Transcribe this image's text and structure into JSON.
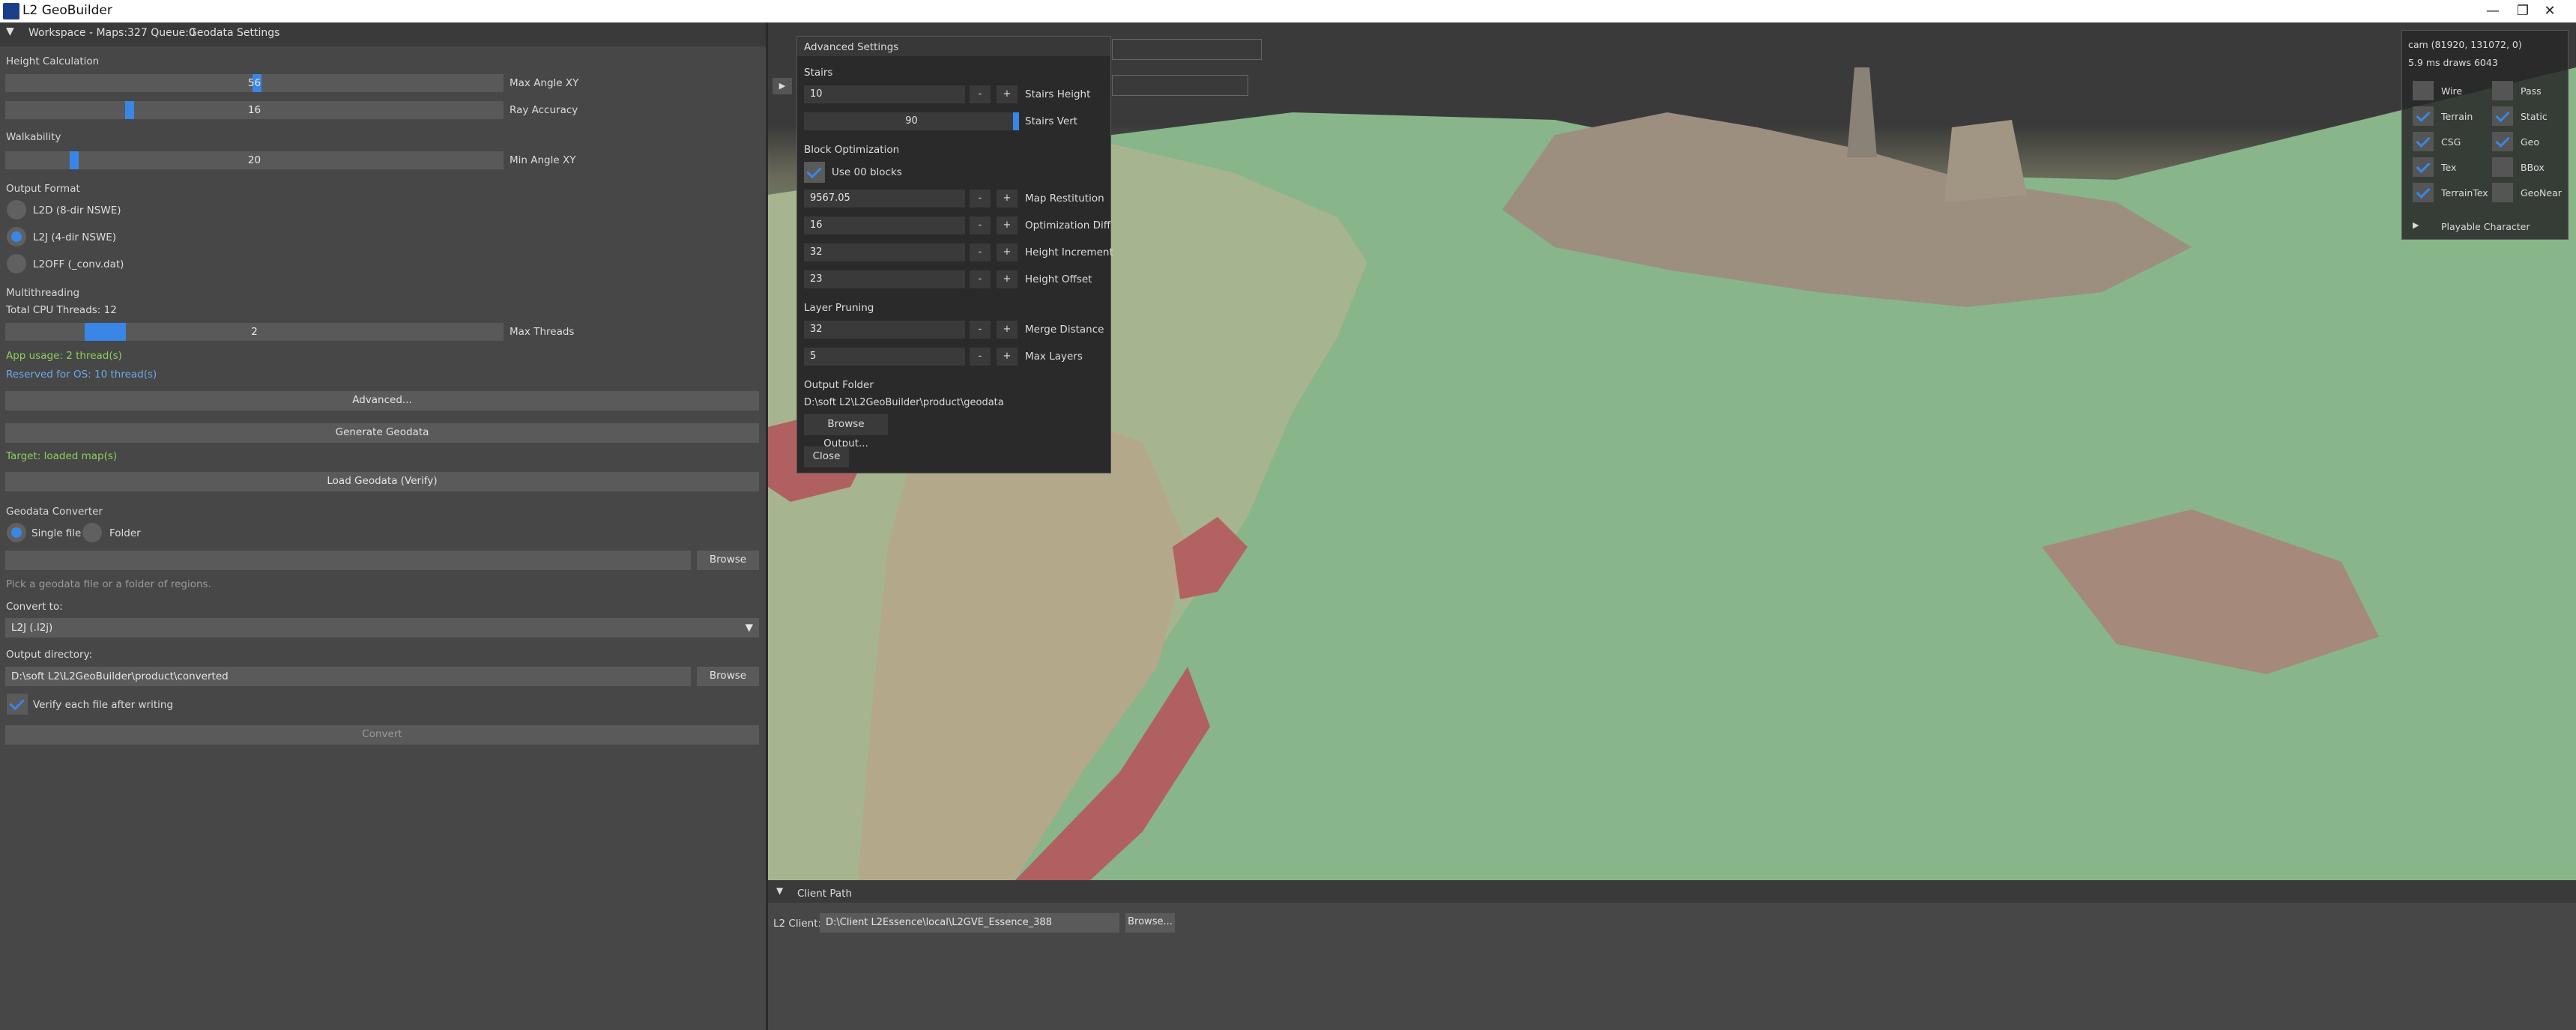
{
  "window": {
    "title": "L2 GeoBuilder",
    "minimize": "—",
    "restore": "❐",
    "close": "✕"
  },
  "menubar": {
    "workspace": "Workspace - Maps:327 Queue:0",
    "tab": "Geodata Settings"
  },
  "height_calc": {
    "title": "Height Calculation",
    "max_angle": {
      "value": "56",
      "label": "Max Angle XY",
      "level": 0.54
    },
    "ray_accuracy": {
      "value": "16",
      "label": "Ray Accuracy",
      "level": 0.24
    }
  },
  "walkability": {
    "title": "Walkability",
    "min_angle": {
      "value": "20",
      "label": "Min Angle XY",
      "level": 0.13
    }
  },
  "output_format": {
    "title": "Output Format",
    "options": [
      {
        "label": "L2D (8-dir NSWE)",
        "selected": false
      },
      {
        "label": "L2J (4-dir NSWE)",
        "selected": true
      },
      {
        "label": "L2OFF (_conv.dat)",
        "selected": false
      }
    ]
  },
  "multithreading": {
    "title": "Multithreading",
    "total": "Total CPU Threads: 12",
    "threads": {
      "value": "2",
      "label": "Max Threads",
      "level": 0.17
    },
    "app_usage": "App usage: 2 thread(s)",
    "reserved": "Reserved for OS: 10 thread(s)"
  },
  "actions": {
    "advanced": "Advanced...",
    "generate": "Generate Geodata",
    "target": "Target: loaded map(s)",
    "load": "Load Geodata (Verify)"
  },
  "converter": {
    "title": "Geodata Converter",
    "single_file": "Single file",
    "folder": "Folder",
    "file_value": "",
    "browse": "Browse",
    "hint": "Pick a geodata file or a folder of regions.",
    "convert_to_label": "Convert to:",
    "convert_to_value": "L2J  (.l2j)",
    "output_dir_label": "Output directory:",
    "output_dir_value": "D:\\soft L2\\L2GeoBuilder\\product\\converted",
    "browse2": "Browse",
    "verify": "Verify each file after writing",
    "convert": "Convert"
  },
  "dialog": {
    "title": "Advanced Settings",
    "stairs_title": "Stairs",
    "stairs_height": {
      "value": "10",
      "label": "Stairs Height"
    },
    "stairs_vert": {
      "value": "90",
      "label": "Stairs Vert",
      "level": 1.0
    },
    "block_title": "Block Optimization",
    "use00": "Use 00 blocks",
    "map_restitution": {
      "value": "9567.05",
      "label": "Map Restitution"
    },
    "opt_diff": {
      "value": "16",
      "label": "Optimization Diff"
    },
    "height_inc": {
      "value": "32",
      "label": "Height Increment"
    },
    "height_off": {
      "value": "23",
      "label": "Height Offset"
    },
    "pruning_title": "Layer Pruning",
    "merge_dist": {
      "value": "32",
      "label": "Merge Distance"
    },
    "max_layers": {
      "value": "5",
      "label": "Max Layers"
    },
    "output_title": "Output Folder",
    "output_path": "D:\\soft L2\\L2GeoBuilder\\product\\geodata",
    "browse_output": "Browse Output...",
    "close": "Close",
    "minus": "-",
    "plus": "+"
  },
  "overlay": {
    "cam": "cam (81920, 131072, 0)",
    "stats": "5.9 ms   draws 6043",
    "toggles": [
      {
        "label": "Wire",
        "on": false
      },
      {
        "label": "Pass",
        "on": false
      },
      {
        "label": "Terrain",
        "on": true
      },
      {
        "label": "Static",
        "on": true
      },
      {
        "label": "CSG",
        "on": true
      },
      {
        "label": "Geo",
        "on": true
      },
      {
        "label": "Tex",
        "on": true
      },
      {
        "label": "BBox",
        "on": false
      },
      {
        "label": "TerrainTex",
        "on": true
      },
      {
        "label": "GeoNear",
        "on": false
      }
    ],
    "playable": "Playable Character"
  },
  "bottom": {
    "tab": "Client Path",
    "client_label": "L2 Client:",
    "client_path": "D:\\Client L2Essence\\local\\L2GVE_Essence_388",
    "browse": "Browse..."
  }
}
